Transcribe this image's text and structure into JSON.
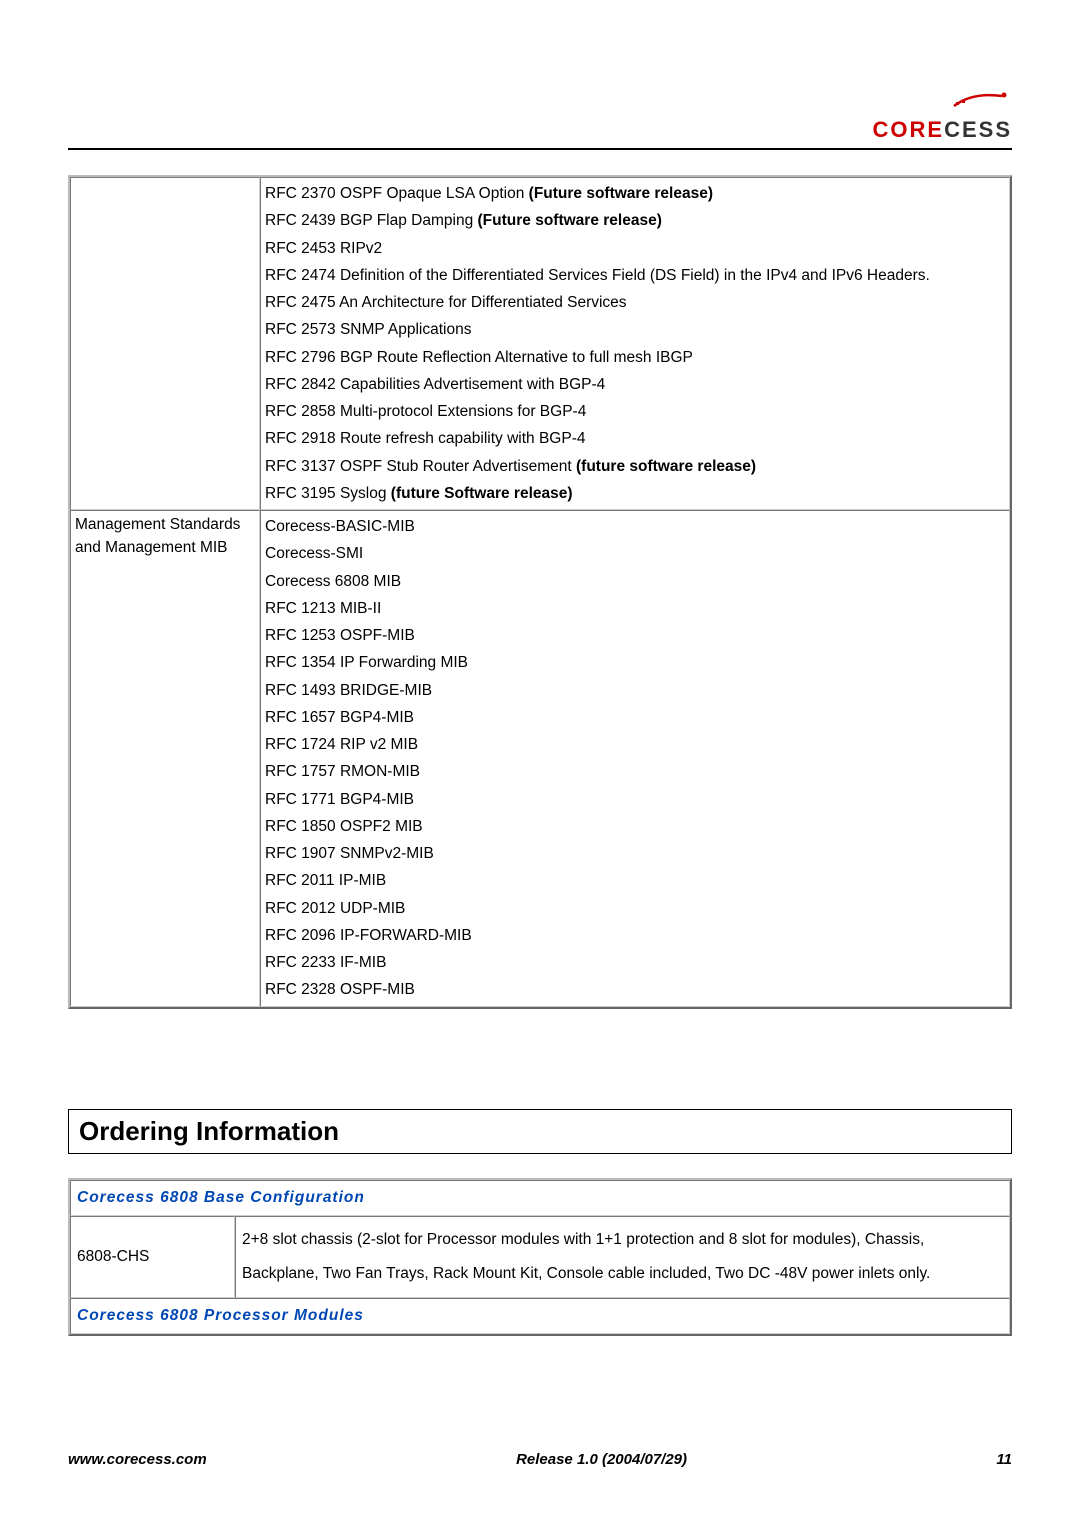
{
  "logo": {
    "prefix": "CORE",
    "suffix": "CESS"
  },
  "spec_rows": [
    {
      "label": "",
      "lines": [
        {
          "text": "RFC 2370 OSPF Opaque LSA Option ",
          "bold_suffix": "(Future software release)"
        },
        {
          "text": "RFC 2439 BGP Flap Damping ",
          "bold_suffix": "(Future software release)"
        },
        {
          "text": "RFC 2453 RIPv2"
        },
        {
          "text": "RFC 2474 Definition of the Differentiated Services Field (DS Field) in the IPv4 and IPv6 Headers."
        },
        {
          "text": "RFC 2475 An Architecture for Differentiated Services"
        },
        {
          "text": "RFC 2573 SNMP Applications"
        },
        {
          "text": "RFC 2796 BGP Route Reflection Alternative to full mesh IBGP"
        },
        {
          "text": "RFC 2842 Capabilities Advertisement with BGP-4"
        },
        {
          "text": "RFC 2858 Multi-protocol Extensions for BGP-4"
        },
        {
          "text": "RFC 2918 Route refresh capability with BGP-4"
        },
        {
          "text": "RFC 3137 OSPF Stub Router Advertisement ",
          "bold_suffix": "(future software release)"
        },
        {
          "text": "RFC 3195 Syslog ",
          "bold_suffix": "(future Software release)"
        }
      ]
    },
    {
      "label": "Management Standards and Management MIB",
      "lines": [
        {
          "text": "Corecess-BASIC-MIB"
        },
        {
          "text": "Corecess-SMI"
        },
        {
          "text": "Corecess 6808 MIB"
        },
        {
          "text": "RFC 1213 MIB-II"
        },
        {
          "text": "RFC 1253 OSPF-MIB"
        },
        {
          "text": "RFC 1354 IP Forwarding MIB"
        },
        {
          "text": "RFC 1493 BRIDGE-MIB"
        },
        {
          "text": "RFC 1657 BGP4-MIB"
        },
        {
          "text": "RFC 1724 RIP v2 MIB"
        },
        {
          "text": "RFC 1757 RMON-MIB"
        },
        {
          "text": "RFC 1771 BGP4-MIB"
        },
        {
          "text": "RFC 1850 OSPF2 MIB"
        },
        {
          "text": "RFC 1907 SNMPv2-MIB"
        },
        {
          "text": "RFC 2011 IP-MIB"
        },
        {
          "text": "RFC 2012 UDP-MIB"
        },
        {
          "text": "RFC 2096 IP-FORWARD-MIB"
        },
        {
          "text": "RFC 2233 IF-MIB"
        },
        {
          "text": "RFC 2328 OSPF-MIB"
        }
      ]
    }
  ],
  "ordering_heading": "Ordering Information",
  "order_sections": {
    "base_config": "Corecess 6808 Base Configuration",
    "proc_modules": "Corecess 6808 Processor Modules"
  },
  "order_item": {
    "code": "6808-CHS",
    "desc": "2+8 slot chassis (2-slot for Processor modules with 1+1 protection and 8 slot for modules), Chassis, Backplane, Two Fan Trays, Rack Mount Kit, Console cable included, Two DC -48V power inlets only."
  },
  "footer": {
    "left": "www.corecess.com",
    "center": "Release 1.0 (2004/07/29)",
    "right": "11"
  }
}
